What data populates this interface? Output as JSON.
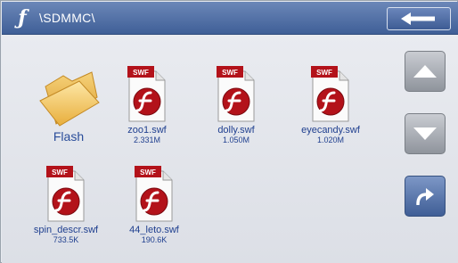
{
  "window": {
    "app_icon": "flash-f-icon",
    "path": "\\SDMMC\\",
    "back_icon": "left-arrow-icon"
  },
  "files": [
    {
      "name": "Flash",
      "size": "",
      "type": "folder",
      "icon": "folder-icon"
    },
    {
      "name": "zoo1.swf",
      "size": "2.331M",
      "type": "swf",
      "icon": "swf-file-icon",
      "badge": "SWF"
    },
    {
      "name": "dolly.swf",
      "size": "1.050M",
      "type": "swf",
      "icon": "swf-file-icon",
      "badge": "SWF"
    },
    {
      "name": "eyecandy.swf",
      "size": "1.020M",
      "type": "swf",
      "icon": "swf-file-icon",
      "badge": "SWF"
    },
    {
      "name": "spin_descr.swf",
      "size": "733.5K",
      "type": "swf",
      "icon": "swf-file-icon",
      "badge": "SWF"
    },
    {
      "name": "44_leto.swf",
      "size": "190.6K",
      "type": "swf",
      "icon": "swf-file-icon",
      "badge": "SWF"
    }
  ],
  "sidebar": {
    "up_icon": "triangle-up-icon",
    "down_icon": "triangle-down-icon",
    "redo_icon": "curved-arrow-right-icon"
  },
  "colors": {
    "titlebar": "#4a69a3",
    "label": "#1f3f8f",
    "swf_red": "#b3121a"
  }
}
